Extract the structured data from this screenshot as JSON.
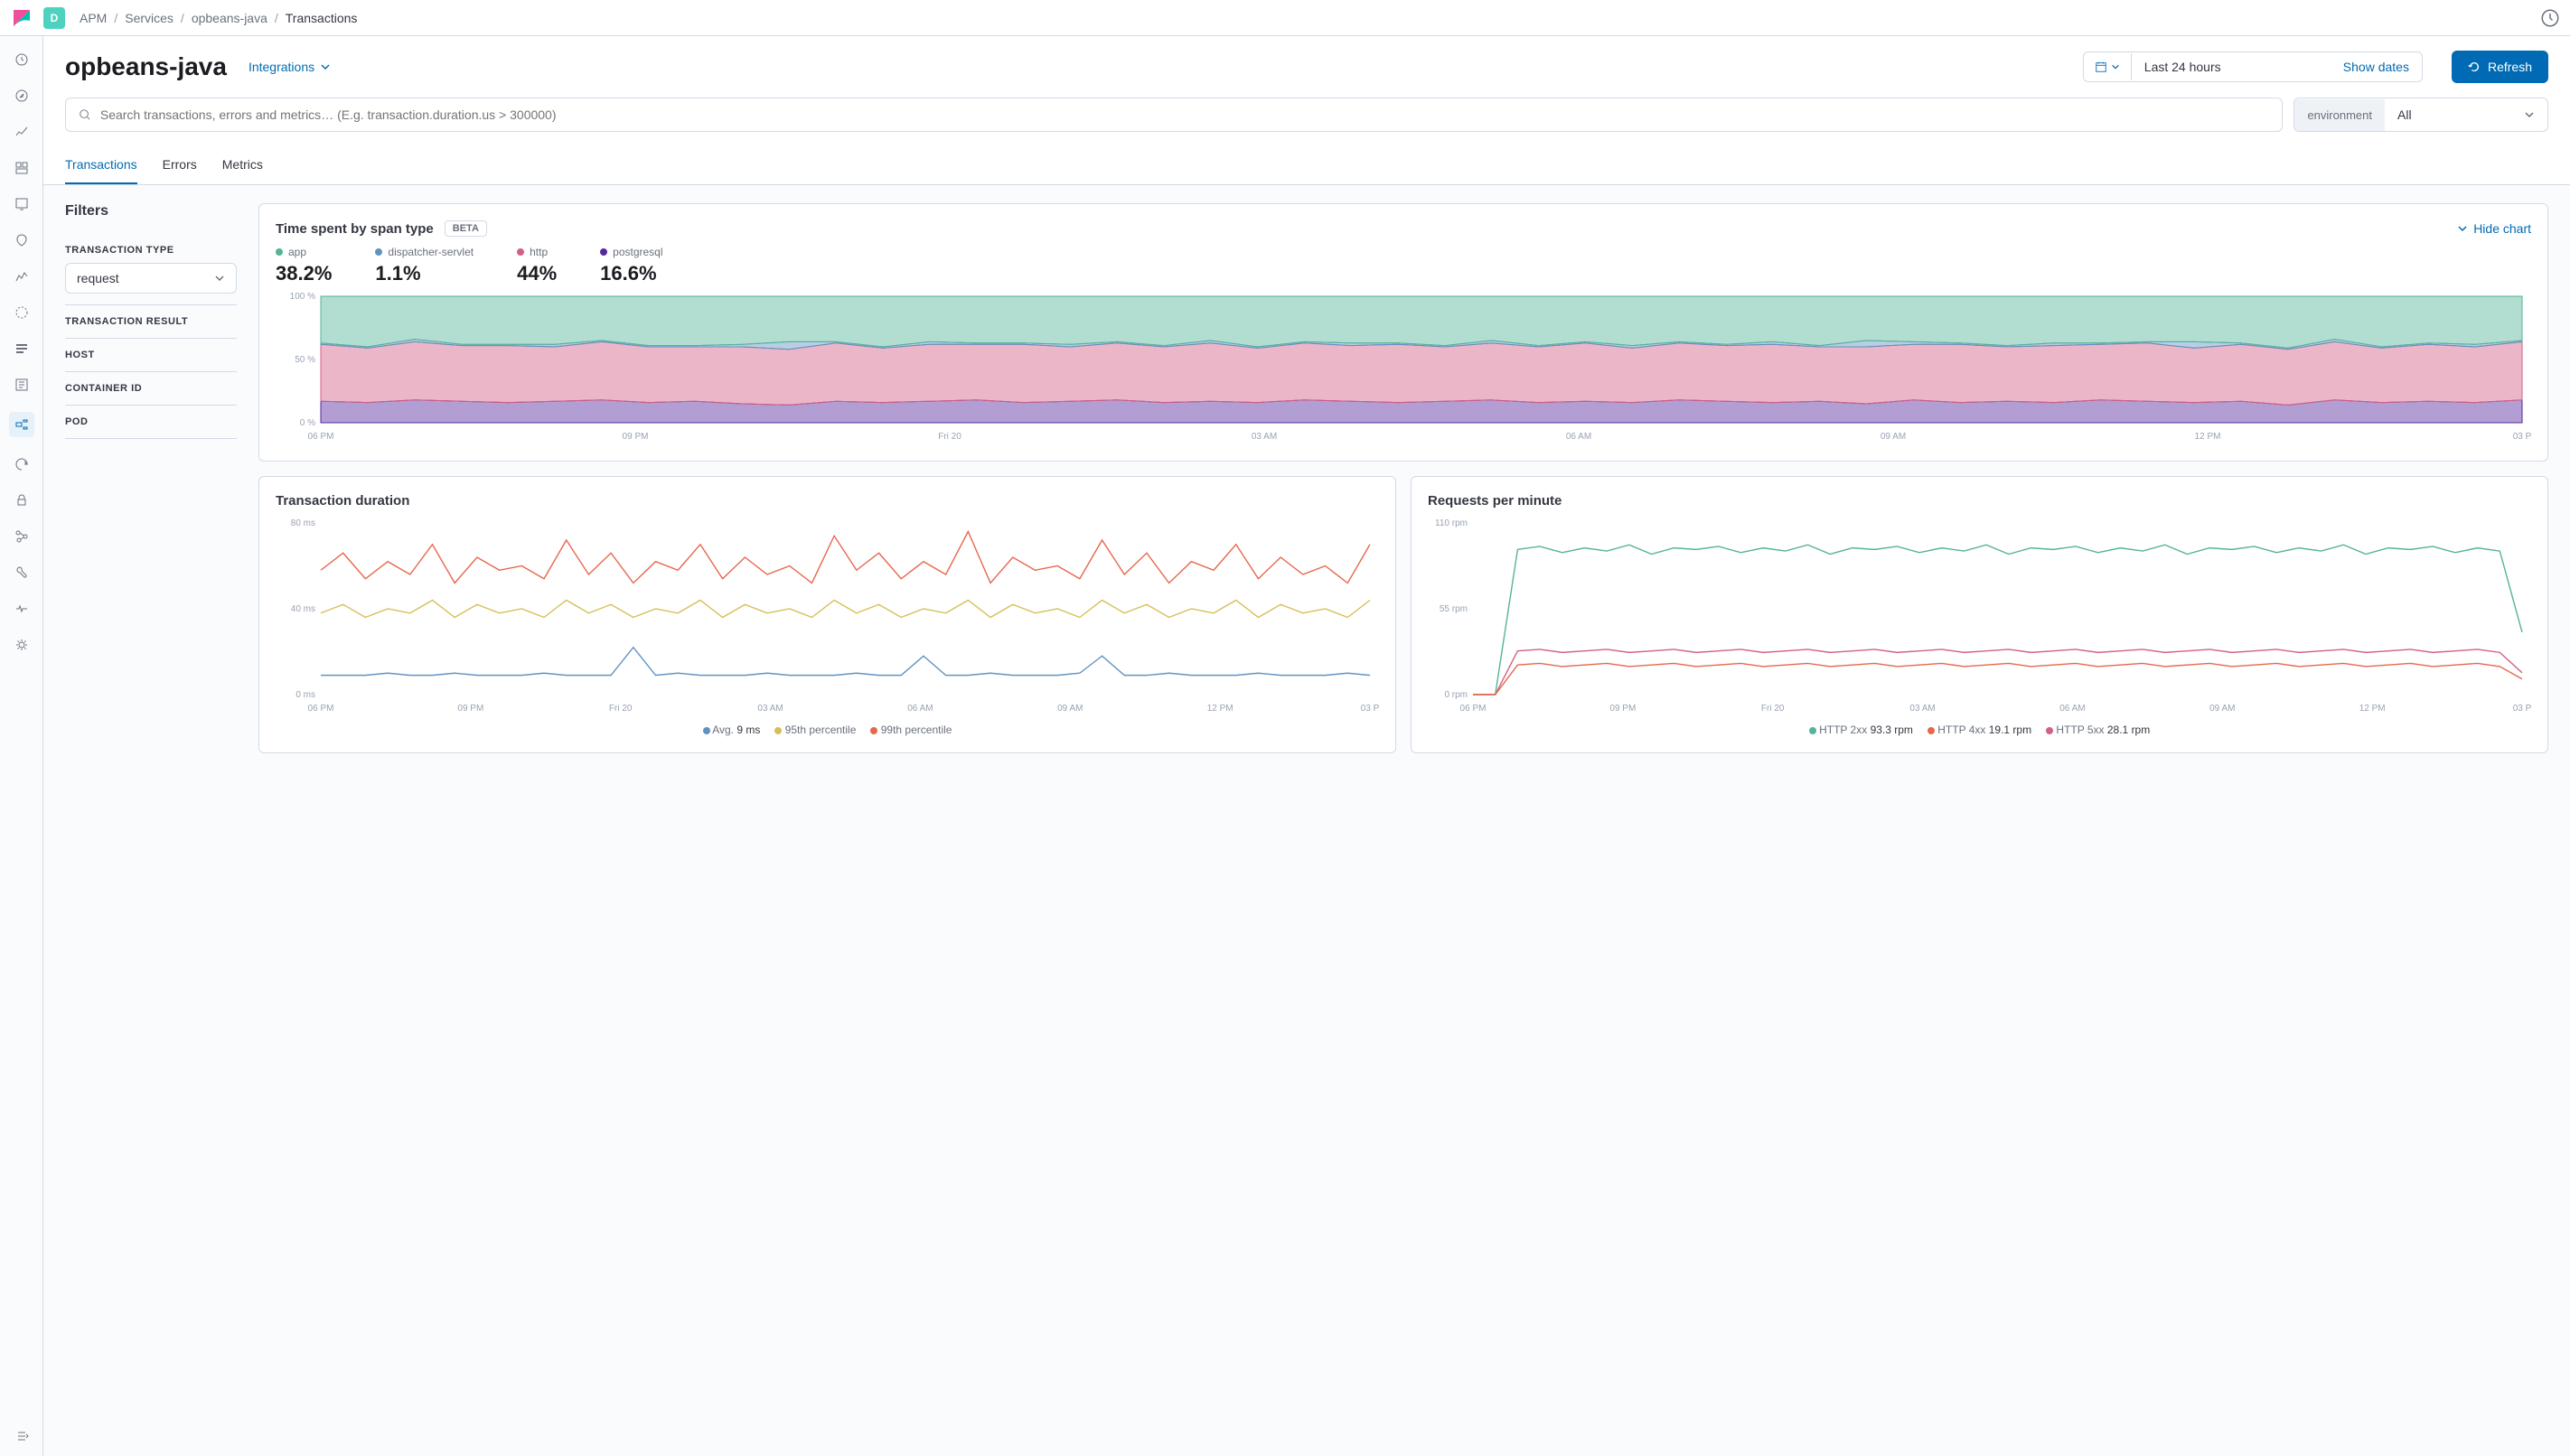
{
  "space_letter": "D",
  "breadcrumbs": [
    "APM",
    "Services",
    "opbeans-java",
    "Transactions"
  ],
  "page_title": "opbeans-java",
  "integrations_label": "Integrations",
  "date_range": "Last 24 hours",
  "show_dates": "Show dates",
  "refresh": "Refresh",
  "search_placeholder": "Search transactions, errors and metrics… (E.g. transaction.duration.us > 300000)",
  "env_label": "environment",
  "env_value": "All",
  "tabs": [
    "Transactions",
    "Errors",
    "Metrics"
  ],
  "active_tab": 0,
  "filters_title": "Filters",
  "filter_sections": {
    "transaction_type": {
      "label": "TRANSACTION TYPE",
      "value": "request"
    },
    "transaction_result": {
      "label": "TRANSACTION RESULT"
    },
    "host": {
      "label": "HOST"
    },
    "container_id": {
      "label": "CONTAINER ID"
    },
    "pod": {
      "label": "POD"
    }
  },
  "span_panel": {
    "title": "Time spent by span type",
    "badge": "BETA",
    "hide": "Hide chart",
    "series": [
      {
        "name": "app",
        "color": "#54b399",
        "value": "38.2%"
      },
      {
        "name": "dispatcher-servlet",
        "color": "#6092c0",
        "value": "1.1%"
      },
      {
        "name": "http",
        "color": "#d36086",
        "value": "44%"
      },
      {
        "name": "postgresql",
        "color": "#54299e",
        "value": "16.6%"
      }
    ]
  },
  "duration_panel": {
    "title": "Transaction duration",
    "legend": [
      {
        "name": "Avg.",
        "color": "#6092c0",
        "value": "9 ms"
      },
      {
        "name": "95th percentile",
        "color": "#d6bf57",
        "value": ""
      },
      {
        "name": "99th percentile",
        "color": "#e7664c",
        "value": ""
      }
    ]
  },
  "rpm_panel": {
    "title": "Requests per minute",
    "legend": [
      {
        "name": "HTTP 2xx",
        "color": "#54b399",
        "value": "93.3 rpm"
      },
      {
        "name": "HTTP 4xx",
        "color": "#e7664c",
        "value": "19.1 rpm"
      },
      {
        "name": "HTTP 5xx",
        "color": "#d36086",
        "value": "28.1 rpm"
      }
    ]
  },
  "chart_data": [
    {
      "type": "area",
      "title": "Time spent by span type",
      "ylabel": "%",
      "ylim": [
        0,
        100
      ],
      "yticks": [
        "0 %",
        "50 %",
        "100 %"
      ],
      "xticks": [
        "06 PM",
        "09 PM",
        "Fri 20",
        "03 AM",
        "06 AM",
        "09 AM",
        "12 PM",
        "03 P"
      ],
      "x": [
        0,
        1,
        2,
        3,
        4,
        5,
        6,
        7,
        8,
        9,
        10,
        11,
        12,
        13,
        14,
        15,
        16,
        17,
        18,
        19,
        20,
        21,
        22,
        23,
        24,
        25,
        26,
        27,
        28,
        29,
        30,
        31,
        32,
        33,
        34,
        35,
        36,
        37,
        38,
        39,
        40,
        41,
        42,
        43,
        44,
        45,
        46,
        47
      ],
      "series": [
        {
          "name": "postgresql",
          "color": "#54299e",
          "values": [
            17,
            16,
            18,
            17,
            16,
            17,
            18,
            16,
            17,
            15,
            14,
            17,
            16,
            17,
            18,
            16,
            17,
            18,
            16,
            17,
            16,
            18,
            17,
            16,
            17,
            18,
            16,
            17,
            16,
            18,
            17,
            16,
            17,
            15,
            18,
            16,
            17,
            16,
            18,
            17,
            16,
            17,
            14,
            18,
            16,
            17,
            16,
            18
          ]
        },
        {
          "name": "http",
          "color": "#d36086",
          "values": [
            45,
            43,
            46,
            44,
            45,
            43,
            46,
            44,
            43,
            45,
            44,
            46,
            43,
            45,
            44,
            46,
            43,
            45,
            44,
            46,
            43,
            45,
            44,
            46,
            43,
            45,
            44,
            46,
            43,
            45,
            44,
            46,
            43,
            45,
            44,
            46,
            43,
            45,
            44,
            46,
            43,
            45,
            44,
            46,
            43,
            45,
            44,
            46
          ]
        },
        {
          "name": "dispatcher-servlet",
          "color": "#6092c0",
          "values": [
            1,
            1,
            2,
            1,
            1,
            2,
            1,
            1,
            1,
            2,
            6,
            1,
            1,
            2,
            1,
            1,
            2,
            1,
            1,
            2,
            1,
            1,
            2,
            1,
            1,
            2,
            1,
            1,
            2,
            1,
            1,
            2,
            1,
            5,
            2,
            1,
            1,
            2,
            1,
            1,
            5,
            1,
            1,
            2,
            1,
            1,
            2,
            1
          ]
        },
        {
          "name": "app",
          "color": "#54b399",
          "values": [
            37,
            40,
            34,
            38,
            38,
            38,
            35,
            39,
            39,
            38,
            36,
            36,
            40,
            36,
            37,
            37,
            38,
            36,
            39,
            35,
            40,
            36,
            37,
            37,
            39,
            35,
            39,
            36,
            39,
            36,
            38,
            36,
            39,
            35,
            36,
            37,
            39,
            37,
            37,
            36,
            36,
            37,
            41,
            34,
            40,
            37,
            38,
            35
          ]
        }
      ]
    },
    {
      "type": "line",
      "title": "Transaction duration",
      "ylabel": "ms",
      "ylim": [
        0,
        80
      ],
      "yticks": [
        "0 ms",
        "40 ms",
        "80 ms"
      ],
      "xticks": [
        "06 PM",
        "09 PM",
        "Fri 20",
        "03 AM",
        "06 AM",
        "09 AM",
        "12 PM",
        "03 P"
      ],
      "x": [
        0,
        1,
        2,
        3,
        4,
        5,
        6,
        7,
        8,
        9,
        10,
        11,
        12,
        13,
        14,
        15,
        16,
        17,
        18,
        19,
        20,
        21,
        22,
        23,
        24,
        25,
        26,
        27,
        28,
        29,
        30,
        31,
        32,
        33,
        34,
        35,
        36,
        37,
        38,
        39,
        40,
        41,
        42,
        43,
        44,
        45,
        46,
        47
      ],
      "series": [
        {
          "name": "Avg.",
          "color": "#6092c0",
          "values": [
            9,
            9,
            9,
            10,
            9,
            9,
            10,
            9,
            9,
            9,
            10,
            9,
            9,
            9,
            22,
            9,
            10,
            9,
            9,
            9,
            10,
            9,
            9,
            9,
            10,
            9,
            9,
            18,
            9,
            9,
            10,
            9,
            9,
            9,
            10,
            18,
            9,
            9,
            10,
            9,
            9,
            9,
            10,
            9,
            9,
            9,
            10,
            9
          ]
        },
        {
          "name": "95th percentile",
          "color": "#d6bf57",
          "values": [
            38,
            42,
            36,
            40,
            38,
            44,
            36,
            42,
            38,
            40,
            36,
            44,
            38,
            42,
            36,
            40,
            38,
            44,
            36,
            42,
            38,
            40,
            36,
            44,
            38,
            42,
            36,
            40,
            38,
            44,
            36,
            42,
            38,
            40,
            36,
            44,
            38,
            42,
            36,
            40,
            38,
            44,
            36,
            42,
            38,
            40,
            36,
            44
          ]
        },
        {
          "name": "99th percentile",
          "color": "#e7664c",
          "values": [
            58,
            66,
            54,
            62,
            56,
            70,
            52,
            64,
            58,
            60,
            54,
            72,
            56,
            66,
            52,
            62,
            58,
            70,
            54,
            64,
            56,
            60,
            52,
            74,
            58,
            66,
            54,
            62,
            56,
            76,
            52,
            64,
            58,
            60,
            54,
            72,
            56,
            66,
            52,
            62,
            58,
            70,
            54,
            64,
            56,
            60,
            52,
            70
          ]
        }
      ]
    },
    {
      "type": "line",
      "title": "Requests per minute",
      "ylabel": "rpm",
      "ylim": [
        0,
        110
      ],
      "yticks": [
        "0 rpm",
        "55 rpm",
        "110 rpm"
      ],
      "xticks": [
        "06 PM",
        "09 PM",
        "Fri 20",
        "03 AM",
        "06 AM",
        "09 AM",
        "12 PM",
        "03 P"
      ],
      "x": [
        0,
        1,
        2,
        3,
        4,
        5,
        6,
        7,
        8,
        9,
        10,
        11,
        12,
        13,
        14,
        15,
        16,
        17,
        18,
        19,
        20,
        21,
        22,
        23,
        24,
        25,
        26,
        27,
        28,
        29,
        30,
        31,
        32,
        33,
        34,
        35,
        36,
        37,
        38,
        39,
        40,
        41,
        42,
        43,
        44,
        45,
        46,
        47
      ],
      "series": [
        {
          "name": "HTTP 2xx",
          "color": "#54b399",
          "values": [
            0,
            0,
            93,
            95,
            91,
            94,
            92,
            96,
            90,
            94,
            93,
            95,
            91,
            94,
            92,
            96,
            90,
            94,
            93,
            95,
            91,
            94,
            92,
            96,
            90,
            94,
            93,
            95,
            91,
            94,
            92,
            96,
            90,
            94,
            93,
            95,
            91,
            94,
            92,
            96,
            90,
            94,
            93,
            95,
            91,
            94,
            92,
            40
          ]
        },
        {
          "name": "HTTP 5xx",
          "color": "#d36086",
          "values": [
            0,
            0,
            28,
            29,
            27,
            28,
            29,
            27,
            28,
            29,
            27,
            28,
            29,
            27,
            28,
            29,
            27,
            28,
            29,
            27,
            28,
            29,
            27,
            28,
            29,
            27,
            28,
            29,
            27,
            28,
            29,
            27,
            28,
            29,
            27,
            28,
            29,
            27,
            28,
            29,
            27,
            28,
            29,
            27,
            28,
            29,
            27,
            14
          ]
        },
        {
          "name": "HTTP 4xx",
          "color": "#e7664c",
          "values": [
            0,
            0,
            19,
            20,
            18,
            19,
            20,
            18,
            19,
            20,
            18,
            19,
            20,
            18,
            19,
            20,
            18,
            19,
            20,
            18,
            19,
            20,
            18,
            19,
            20,
            18,
            19,
            20,
            18,
            19,
            20,
            18,
            19,
            20,
            18,
            19,
            20,
            18,
            19,
            20,
            18,
            19,
            20,
            18,
            19,
            20,
            18,
            10
          ]
        }
      ]
    }
  ]
}
